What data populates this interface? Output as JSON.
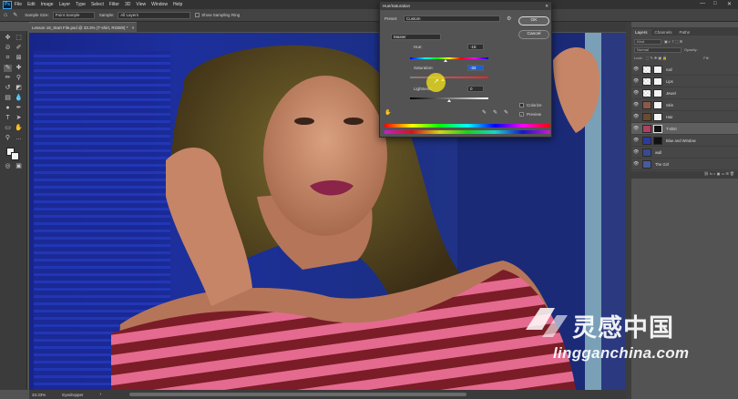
{
  "app": {
    "logo": "Ps"
  },
  "menu": [
    "File",
    "Edit",
    "Image",
    "Layer",
    "Type",
    "Select",
    "Filter",
    "3D",
    "View",
    "Window",
    "Help"
  ],
  "window_controls": {
    "minimize": "—",
    "maximize": "□",
    "close": "✕"
  },
  "options_bar": {
    "sample_size_label": "Sample Size:",
    "sample_size_value": "Point Sample",
    "sample_label": "Sample:",
    "sample_value": "All Layers",
    "show_ring_label": "Show Sampling Ring"
  },
  "document": {
    "tab_title": "Lesson 18_Start File.psd @ 33.3% (T-shirt, RGB/8) *",
    "tab_close": "×"
  },
  "status_bar": {
    "zoom": "33.33%",
    "tool": "Eyedropper",
    "arrow": "›"
  },
  "dialog": {
    "title": "Hue/Saturation",
    "close": "✕",
    "preset_label": "Preset:",
    "preset_value": "Custom",
    "channel_value": "Master",
    "hue_label": "Hue:",
    "hue_value": "-18",
    "saturation_label": "Saturation:",
    "saturation_value": "-32",
    "lightness_label": "Lightness:",
    "lightness_value": "0",
    "colorize_label": "Colorize",
    "preview_label": "Preview",
    "colorize_checked": false,
    "preview_checked": true,
    "ok_label": "OK",
    "cancel_label": "Cancel",
    "hue_level": 0.45,
    "saturation_level": 0.42,
    "lightness_level": 0.5
  },
  "layers_panel": {
    "tabs": [
      "Layers",
      "Channels",
      "Paths"
    ],
    "kind_label": "Kind",
    "mode_label": "Normal",
    "opacity_label": "Opacity:",
    "lock_label": "Lock:",
    "fill_label": "Fill:",
    "layers": [
      {
        "name": "nail",
        "selected": false
      },
      {
        "name": "Lips",
        "selected": false
      },
      {
        "name": "Jewel",
        "selected": false
      },
      {
        "name": "Skin",
        "selected": false
      },
      {
        "name": "Hair",
        "selected": false
      },
      {
        "name": "T-shirt",
        "selected": true
      },
      {
        "name": "Blue and Window",
        "selected": false
      },
      {
        "name": "wall",
        "selected": false
      },
      {
        "name": "The Girl",
        "selected": false
      }
    ]
  },
  "watermark": {
    "cn_text": "灵感中国",
    "url": "lingganchina.com"
  },
  "colors": {
    "ui_dark": "#323232",
    "ui_panel": "#535353",
    "canvas_blue": "#1c2f8a",
    "cursor_highlight": "#f5e61a"
  }
}
